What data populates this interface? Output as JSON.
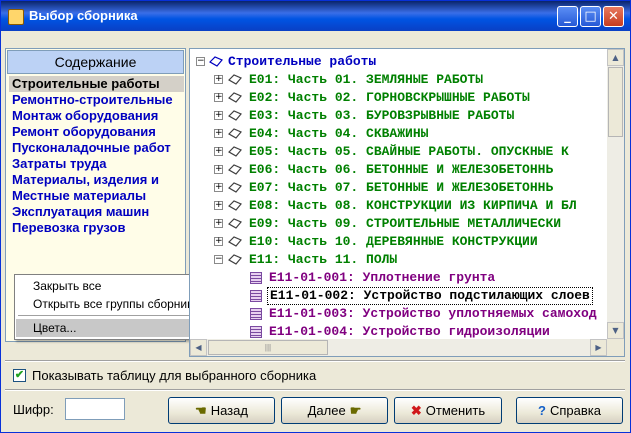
{
  "window": {
    "title": "Выбор сборника"
  },
  "left": {
    "header": "Содержание",
    "items": [
      "Строительные работы",
      "Ремонтно-строительные",
      "Монтаж оборудования",
      "Ремонт оборудования",
      "Пусконаладочные работ",
      "Затраты труда",
      "Материалы, изделия и",
      "Местные материалы",
      "Эксплуатация машин",
      "Перевозка грузов"
    ],
    "selected_index": 0
  },
  "context_menu": {
    "items": [
      "Закрыть все",
      "Открыть все группы сборников",
      "Цвета..."
    ]
  },
  "tree": {
    "root": "Строительные работы",
    "parts": [
      "E01: Часть 01. ЗЕМЛЯНЫЕ РАБОТЫ",
      "E02: Часть 02. ГОРНОВСКРЫШНЫЕ РАБОТЫ",
      "E03: Часть 03. БУРОВЗРЫВНЫЕ РАБОТЫ",
      "E04: Часть 04. СКВАЖИНЫ",
      "E05: Часть 05. СВАЙНЫЕ РАБОТЫ. ОПУСКНЫЕ К",
      "E06: Часть 06. БЕТОННЫЕ И ЖЕЛЕЗОБЕТОННЬ",
      "E07: Часть 07. БЕТОННЫЕ И ЖЕЛЕЗОБЕТОННЬ",
      "E08: Часть 08. КОНСТРУКЦИИ ИЗ КИРПИЧА И БЛ",
      "E09: Часть 09. СТРОИТЕЛЬНЫЕ МЕТАЛЛИЧЕСКИ",
      "E10: Часть 10. ДЕРЕВЯННЫЕ КОНСТРУКЦИИ",
      "E11: Часть 11. ПОЛЫ"
    ],
    "items": [
      "E11-01-001: Уплотнение грунта",
      "E11-01-002: Устройство подстилающих слоев",
      "E11-01-003: Устройство уплотняемых самоход",
      "E11-01-004: Устройство гидроизоляции"
    ],
    "selected_item_index": 1
  },
  "show_table": {
    "label": "Показывать таблицу для выбранного сборника",
    "checked": true
  },
  "cipher": {
    "label": "Шифр:",
    "value": ""
  },
  "buttons": {
    "back": "Назад",
    "next": "Далее",
    "cancel": "Отменить",
    "help": "Справка"
  },
  "colors": {
    "root": "#0000c0",
    "part": "#008000",
    "item": "#800080"
  }
}
